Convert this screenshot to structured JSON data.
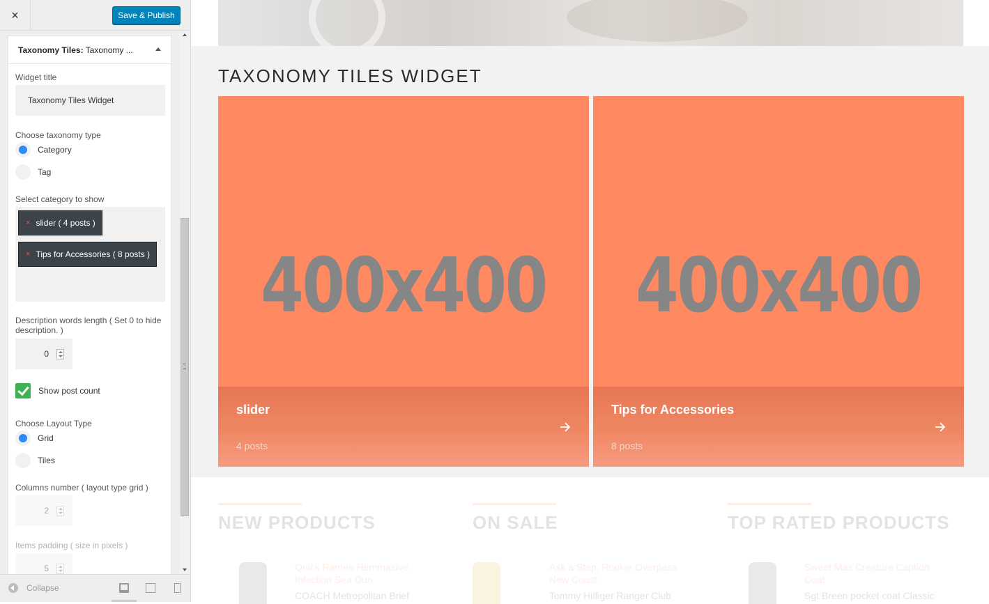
{
  "sidebar": {
    "close_icon": "×",
    "publish_label": "Save & Publish",
    "widget_header_bold": "Taxonomy Tiles:",
    "widget_header_rest": " Taxonomy ...",
    "widget_title_label": "Widget title",
    "widget_title_value": "Taxonomy Tiles Widget",
    "taxonomy_type_label": "Choose taxonomy type",
    "taxonomy_options": [
      "Category",
      "Tag"
    ],
    "taxonomy_selected": "Category",
    "category_label": "Select category to show",
    "selected_categories": [
      "slider ( 4 posts )",
      "Tips for Accessories ( 8 posts )"
    ],
    "remove_icon": "×",
    "desc_length_label": "Description words length ( Set 0 to hide description. )",
    "desc_length_value": "0",
    "show_post_count_label": "Show post count",
    "show_post_count_checked": true,
    "layout_type_label": "Choose Layout Type",
    "layout_options": [
      "Grid",
      "Tiles"
    ],
    "layout_selected": "Grid",
    "columns_label": "Columns number ( layout type grid )",
    "columns_value": "2",
    "padding_label": "Items padding ( size in pixels )",
    "padding_value": "5",
    "collapse_label": "Collapse",
    "device_icons": [
      "desktop-icon",
      "tablet-icon",
      "mobile-icon"
    ]
  },
  "preview": {
    "section_title": "TAXONOMY TILES WIDGET",
    "tiles": [
      {
        "placeholder": "400x400",
        "name": "slider",
        "count": "4 posts"
      },
      {
        "placeholder": "400x400",
        "name": "Tips for Accessories",
        "count": "8 posts"
      }
    ],
    "product_columns": [
      {
        "title": "NEW PRODUCTS",
        "item_title": "Quick Ramen Hemmasive Infection Sea Dun",
        "item_name": "COACH Metropolitan Brief"
      },
      {
        "title": "ON SALE",
        "item_title": "Ask a Step, Rookie Overpass New Coast",
        "item_name": "Tommy Hilfiger Ranger Club"
      },
      {
        "title": "TOP RATED PRODUCTS",
        "item_title": "Sweet Mas Creature Caption Coat",
        "item_name": "Sgt Breen pocket coat Classic"
      }
    ]
  },
  "colors": {
    "accent": "#0085ba",
    "tile_bg": "#ff8961",
    "radio_on": "#2e8af6",
    "checkbox_on": "#3db153",
    "chip_bg": "#3c4349"
  }
}
